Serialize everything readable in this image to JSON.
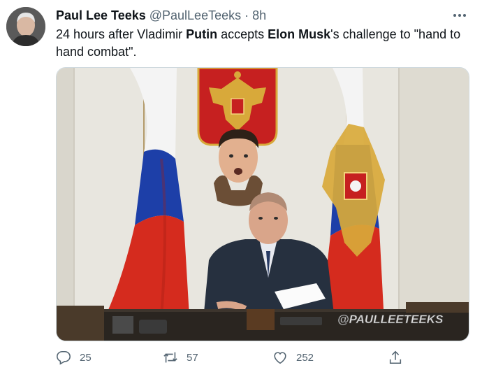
{
  "tweet": {
    "author_name": "Paul Lee Teeks",
    "author_handle": "@PaulLeeTeeks",
    "separator": "·",
    "time": "8h",
    "text": {
      "part1": "24 hours after Vladimir ",
      "bold1": "Putin",
      "part2": " accepts ",
      "bold2": "Elon Musk",
      "part3": "'s challenge to \"hand to hand combat\"."
    },
    "media_watermark": "@PAULLEETEEKS"
  },
  "actions": {
    "reply_count": "25",
    "retweet_count": "57",
    "like_count": "252"
  },
  "icons": {
    "reply": "reply-icon",
    "retweet": "retweet-icon",
    "like": "heart-icon",
    "share": "share-icon",
    "more": "more-icon"
  },
  "colors": {
    "text_secondary": "#536471",
    "flag_white": "#f4f4f4",
    "flag_blue": "#1d3fa8",
    "flag_red": "#d52b1e",
    "emblem_red": "#c62020",
    "emblem_gold": "#d8a93a"
  }
}
